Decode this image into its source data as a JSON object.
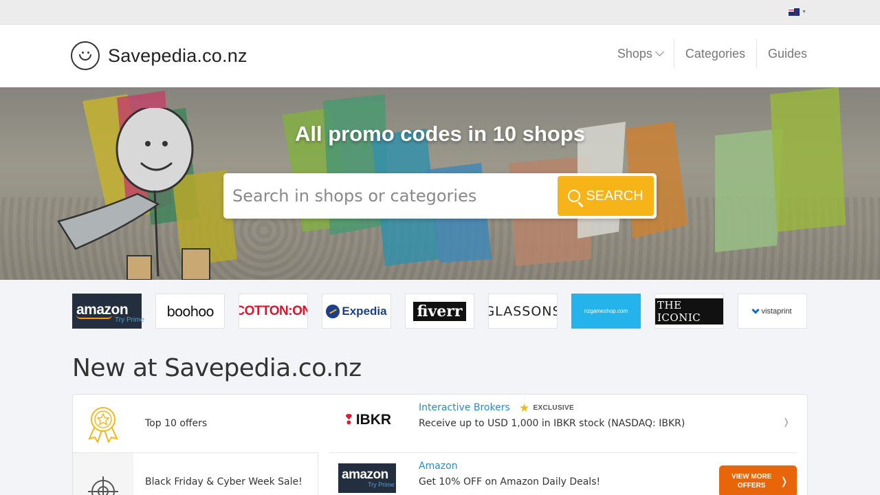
{
  "site": {
    "name": "Savepedia.co.nz"
  },
  "nav": {
    "items": [
      "Shops",
      "Categories",
      "Guides"
    ]
  },
  "hero": {
    "title": "All promo codes in 10 shops",
    "search_placeholder": "Search in shops or categories",
    "search_button": "SEARCH"
  },
  "shops": [
    {
      "name": "amazon",
      "sub": "Try Prime"
    },
    {
      "name": "boohoo"
    },
    {
      "name": "COTTON:ON"
    },
    {
      "name": "Expedia"
    },
    {
      "name": "fiverr"
    },
    {
      "name": "GLASSONS"
    },
    {
      "name": "nzgameshop.com"
    },
    {
      "name": "THE ICONIC"
    },
    {
      "name": "vistaprint"
    }
  ],
  "section": {
    "title": "New at Savepedia.co.nz"
  },
  "categories": [
    {
      "label": "Top 10 offers",
      "icon": "award-ribbon-icon"
    },
    {
      "label": "Black Friday & Cyber Week Sale!",
      "icon": "crosshair-icon"
    }
  ],
  "offers": [
    {
      "shop": "Interactive Brokers",
      "logo": "IBKR",
      "badge": "EXCLUSIVE",
      "description": "Receive up to USD 1,000 in IBKR stock (NASDAQ: IBKR)"
    },
    {
      "shop": "Amazon",
      "logo": "amazon",
      "logo_sub": "Try Prime",
      "description": "Get 10% OFF on Amazon Daily Deals!",
      "button": "VIEW MORE OFFERS"
    }
  ],
  "colors": {
    "accent": "#f7b418",
    "link": "#2a8ac6",
    "cta": "#e8650a"
  }
}
